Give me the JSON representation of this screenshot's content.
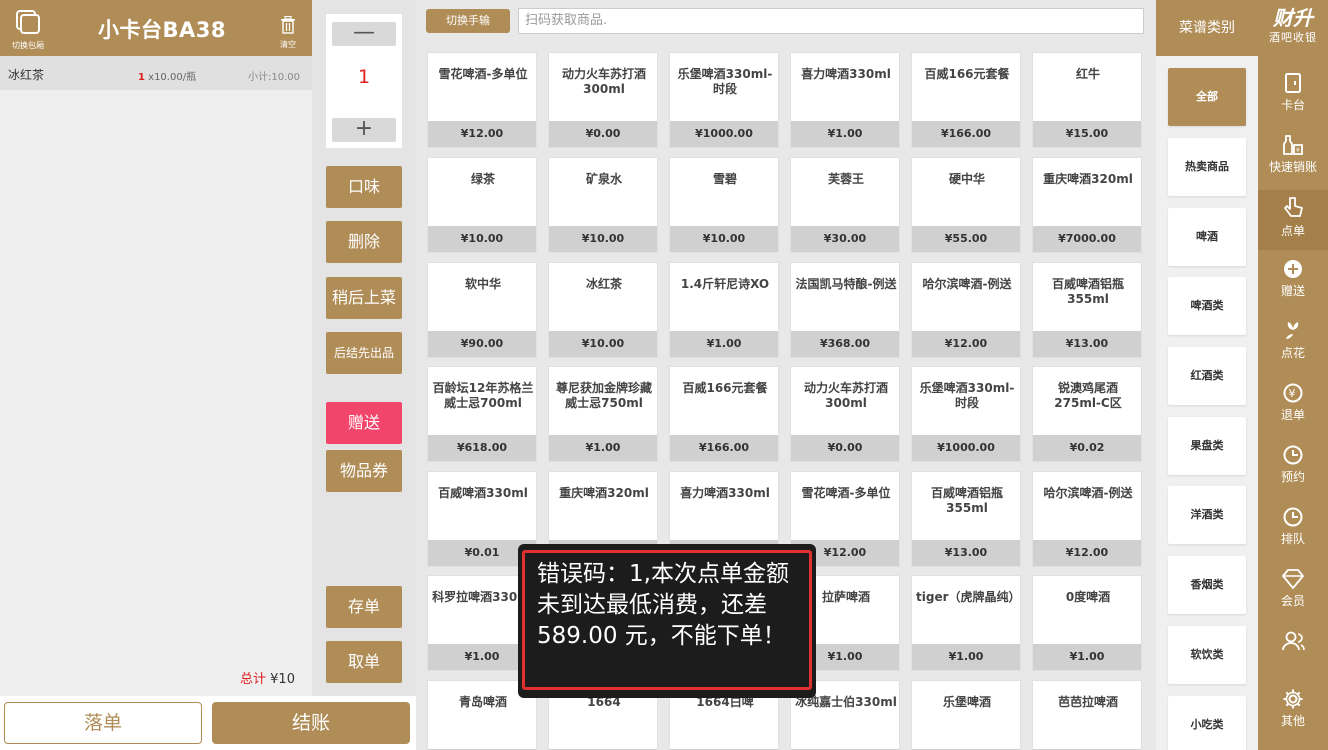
{
  "order": {
    "switch_room_label": "切换包厢",
    "table_name": "小卡台BA38",
    "clear_label": "清空",
    "items": [
      {
        "name": "冰红茶",
        "qty": "1",
        "unit": "x10.00/瓶",
        "subtotal": "小计:10.00"
      }
    ],
    "total_label": "总计",
    "total_value": "¥10"
  },
  "bottom": {
    "submit": "落单",
    "checkout": "结账"
  },
  "controls": {
    "minus": "—",
    "qty": "1",
    "plus": "+",
    "taste": "口味",
    "delete": "删除",
    "serve_later": "稍后上菜",
    "checkout_first": "后结先出品",
    "gift": "赠送",
    "voucher": "物品券",
    "save_order": "存单",
    "take_order": "取单"
  },
  "search": {
    "switch_manual": "切换手输",
    "placeholder": "扫码获取商品."
  },
  "products": [
    {
      "name": "雪花啤酒-多单位",
      "price": "¥12.00"
    },
    {
      "name": "动力火车苏打酒300ml",
      "price": "¥0.00"
    },
    {
      "name": "乐堡啤酒330ml-时段",
      "price": "¥1000.00"
    },
    {
      "name": "喜力啤酒330ml",
      "price": "¥1.00"
    },
    {
      "name": "百威166元套餐",
      "price": "¥166.00"
    },
    {
      "name": "红牛",
      "price": "¥15.00"
    },
    {
      "name": "绿茶",
      "price": "¥10.00"
    },
    {
      "name": "矿泉水",
      "price": "¥10.00"
    },
    {
      "name": "雪碧",
      "price": "¥10.00"
    },
    {
      "name": "芙蓉王",
      "price": "¥30.00"
    },
    {
      "name": "硬中华",
      "price": "¥55.00"
    },
    {
      "name": "重庆啤酒320ml",
      "price": "¥7000.00"
    },
    {
      "name": "软中华",
      "price": "¥90.00"
    },
    {
      "name": "冰红茶",
      "price": "¥10.00"
    },
    {
      "name": "1.4斤轩尼诗XO",
      "price": "¥1.00"
    },
    {
      "name": "法国凯马特酿-例送",
      "price": "¥368.00"
    },
    {
      "name": "哈尔滨啤酒-例送",
      "price": "¥12.00"
    },
    {
      "name": "百威啤酒铝瓶355ml",
      "price": "¥13.00"
    },
    {
      "name": "百龄坛12年苏格兰威士忌700ml",
      "price": "¥618.00"
    },
    {
      "name": "尊尼获加金牌珍藏威士忌750ml",
      "price": "¥1.00"
    },
    {
      "name": "百威166元套餐",
      "price": "¥166.00"
    },
    {
      "name": "动力火车苏打酒300ml",
      "price": "¥0.00"
    },
    {
      "name": "乐堡啤酒330ml-时段",
      "price": "¥1000.00"
    },
    {
      "name": "锐澳鸡尾酒275ml-C区",
      "price": "¥0.02"
    },
    {
      "name": "百威啤酒330ml",
      "price": "¥0.01"
    },
    {
      "name": "重庆啤酒320ml",
      "price": ""
    },
    {
      "name": "喜力啤酒330ml",
      "price": ""
    },
    {
      "name": "雪花啤酒-多单位",
      "price": "¥12.00"
    },
    {
      "name": "百威啤酒铝瓶355ml",
      "price": "¥13.00"
    },
    {
      "name": "哈尔滨啤酒-例送",
      "price": "¥12.00"
    },
    {
      "name": "科罗拉啤酒330ml",
      "price": "¥1.00"
    },
    {
      "name": "",
      "price": ""
    },
    {
      "name": "",
      "price": "¥1.00"
    },
    {
      "name": "拉萨啤酒",
      "price": "¥1.00"
    },
    {
      "name": "tiger（虎牌晶纯）",
      "price": "¥1.00"
    },
    {
      "name": "0度啤酒",
      "price": "¥1.00"
    },
    {
      "name": "青岛啤酒",
      "price": ""
    },
    {
      "name": "1664",
      "price": ""
    },
    {
      "name": "1664白啤",
      "price": ""
    },
    {
      "name": "冰纯嘉士伯330ml",
      "price": ""
    },
    {
      "name": "乐堡啤酒",
      "price": ""
    },
    {
      "name": "芭芭拉啤酒",
      "price": ""
    }
  ],
  "categories": {
    "header": "菜谱类别",
    "items": [
      "全部",
      "热卖商品",
      "啤酒",
      "啤酒类",
      "红酒类",
      "果盘类",
      "洋酒类",
      "香烟类",
      "软饮类",
      "小吃类"
    ]
  },
  "nav": {
    "brand": "财升",
    "brand_sub": "酒吧收银",
    "items": [
      "卡台",
      "快速销账",
      "点单",
      "赠送",
      "点花",
      "退单",
      "预约",
      "排队",
      "会员",
      "其他"
    ]
  },
  "toast": {
    "text": "错误码：1,本次点单金额未到达最低消费，还差 589.00 元，不能下单！"
  },
  "colors": {
    "accent": "#b08d57",
    "pink": "#f2456c",
    "error_red": "#e03030"
  }
}
